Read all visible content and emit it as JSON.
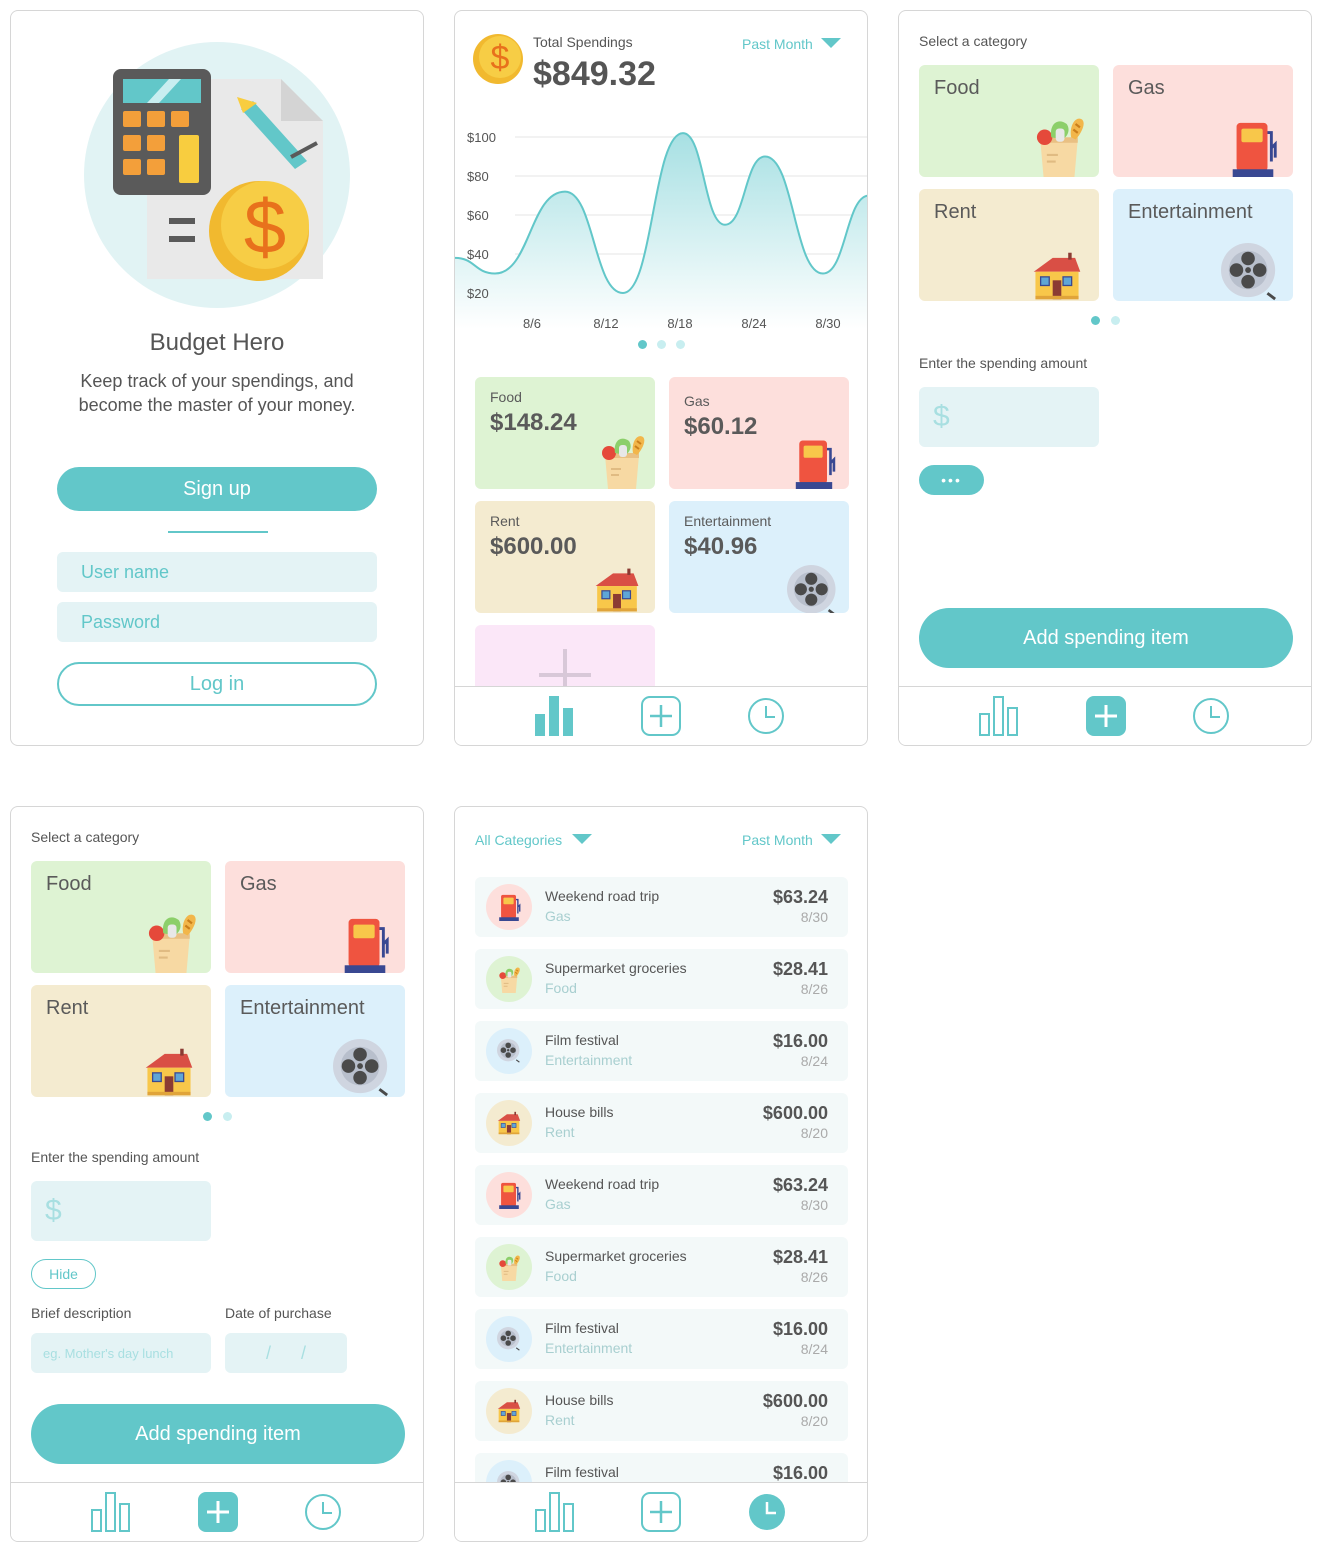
{
  "colors": {
    "accent": "#62c7c9",
    "food": "#def3d3",
    "gas": "#fddfdc",
    "rent": "#f4ebd0",
    "entertainment": "#dcf0fb",
    "add": "#fbe7f8"
  },
  "login": {
    "app_title": "Budget Hero",
    "tagline_1": "Keep track of your spendings, and",
    "tagline_2": "become the master of your money.",
    "signup_label": "Sign up",
    "username_placeholder": "User name",
    "password_placeholder": "Password",
    "login_label": "Log in"
  },
  "dashboard": {
    "total_label": "Total Spendings",
    "total_value": "$849.32",
    "period": "Past Month",
    "tiles": [
      {
        "name": "Food",
        "amount": "$148.24"
      },
      {
        "name": "Gas",
        "amount": "$60.12"
      },
      {
        "name": "Rent",
        "amount": "$600.00"
      },
      {
        "name": "Entertainment",
        "amount": "$40.96"
      }
    ]
  },
  "chart_data": {
    "type": "area",
    "y_tick_labels": [
      "$100",
      "$80",
      "$60",
      "$40",
      "$20"
    ],
    "x_tick_labels": [
      "8/6",
      "8/12",
      "8/18",
      "8/24",
      "8/30"
    ],
    "x": [
      1,
      3,
      6,
      9,
      12,
      15,
      18,
      21,
      24,
      27,
      30,
      31
    ],
    "values": [
      38,
      30,
      72,
      20,
      102,
      55,
      90,
      30,
      70
    ],
    "ylim": [
      0,
      110
    ],
    "grid": true
  },
  "add_form": {
    "select_label": "Select a category",
    "categories": [
      "Food",
      "Gas",
      "Rent",
      "Entertainment"
    ],
    "amount_label": "Enter the spending amount",
    "currency_symbol": "$",
    "more_label": "•••",
    "hide_label": "Hide",
    "description_label": "Brief description",
    "description_placeholder": "eg. Mother's day lunch",
    "date_label": "Date of purchase",
    "date_placeholder": "/      /",
    "submit_label": "Add spending item"
  },
  "history": {
    "category_filter": "All Categories",
    "period": "Past Month",
    "items": [
      {
        "title": "Weekend road trip",
        "category": "Gas",
        "amount": "$63.24",
        "date": "8/30"
      },
      {
        "title": "Supermarket groceries",
        "category": "Food",
        "amount": "$28.41",
        "date": "8/26"
      },
      {
        "title": "Film festival",
        "category": "Entertainment",
        "amount": "$16.00",
        "date": "8/24"
      },
      {
        "title": "House bills",
        "category": "Rent",
        "amount": "$600.00",
        "date": "8/20"
      },
      {
        "title": "Weekend road trip",
        "category": "Gas",
        "amount": "$63.24",
        "date": "8/30"
      },
      {
        "title": "Supermarket groceries",
        "category": "Food",
        "amount": "$28.41",
        "date": "8/26"
      },
      {
        "title": "Film festival",
        "category": "Entertainment",
        "amount": "$16.00",
        "date": "8/24"
      },
      {
        "title": "House bills",
        "category": "Rent",
        "amount": "$600.00",
        "date": "8/20"
      },
      {
        "title": "Film festival",
        "category": "",
        "amount": "$16.00",
        "date": ""
      }
    ]
  }
}
